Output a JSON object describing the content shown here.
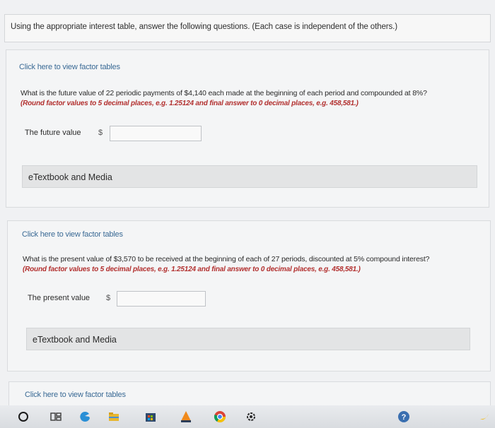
{
  "instruction": "Using the appropriate interest table, answer the following questions. (Each case is independent of the others.)",
  "q1": {
    "link": "Click here to view factor tables",
    "question": "What is the future value of 22 periodic payments of $4,140 each made at the beginning of each period and compounded at 8%?",
    "hint": "(Round factor values to 5 decimal places, e.g. 1.25124 and final answer to 0 decimal places, e.g. 458,581.)",
    "answer_label": "The future value",
    "currency": "$",
    "value": "",
    "etext": "eTextbook and Media"
  },
  "q2": {
    "link": "Click here to view factor tables",
    "question": "What is the present value of $3,570 to be received at the beginning of each of 27 periods, discounted at 5% compound interest?",
    "hint": "(Round factor values to 5 decimal places, e.g. 1.25124 and final answer to 0 decimal places, e.g. 458,581.)",
    "answer_label": "The present value",
    "currency": "$",
    "value": "",
    "etext": "eTextbook and Media"
  },
  "q3": {
    "link": "Click here to view factor tables"
  },
  "taskbar": {
    "icons": [
      "search-icon",
      "task-view-icon",
      "edge-icon",
      "file-explorer-icon",
      "store-icon",
      "vlc-icon",
      "chrome-icon",
      "settings-icon",
      "help-icon",
      "banana-icon"
    ]
  }
}
